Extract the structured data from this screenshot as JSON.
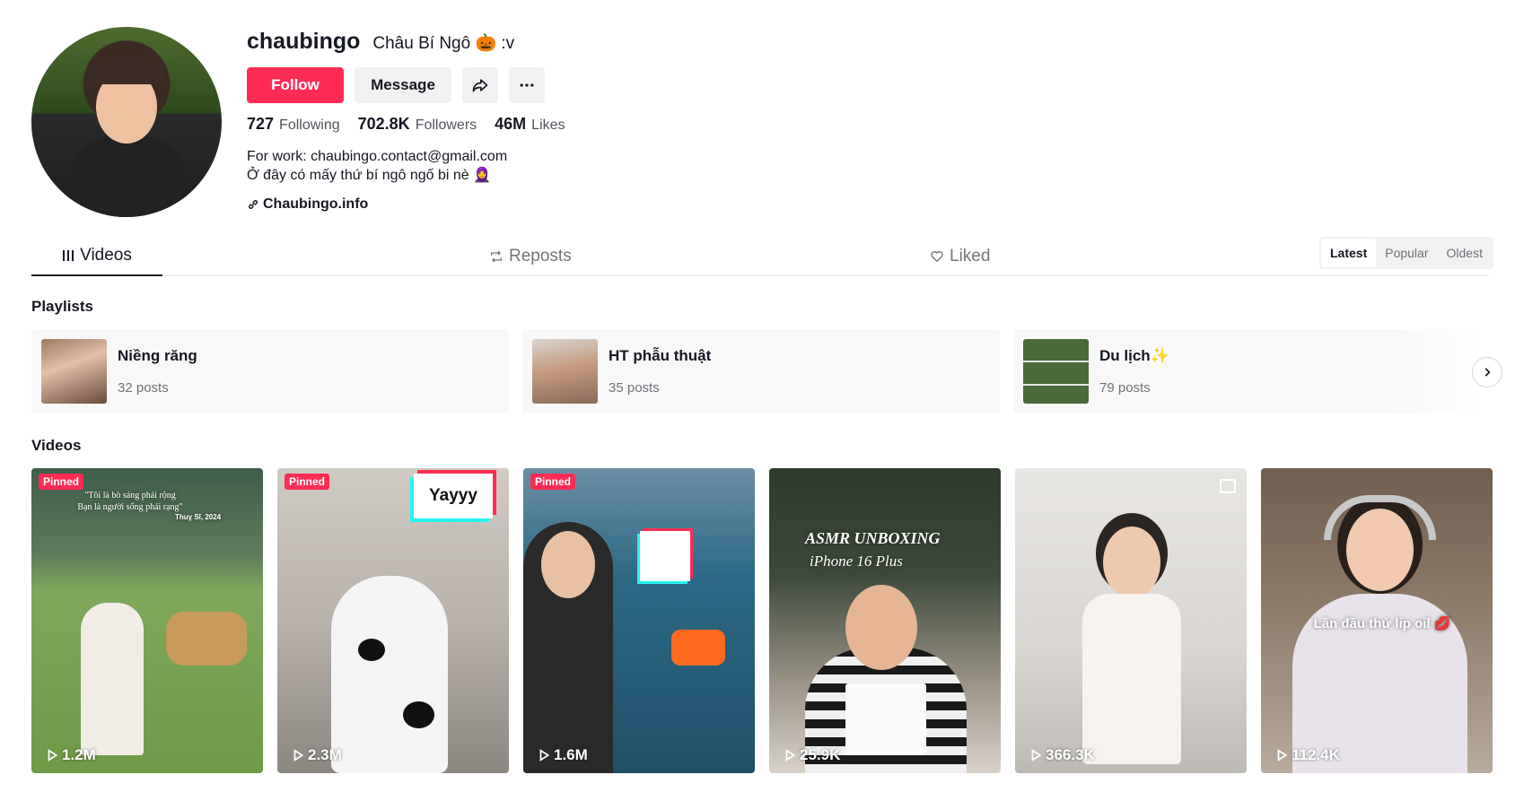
{
  "profile": {
    "username": "chaubingo",
    "nickname": "Châu Bí Ngô 🎃 :v",
    "follow_label": "Follow",
    "message_label": "Message",
    "share_icon": "share-icon",
    "more_icon": "more-icon",
    "stats": {
      "following_count": "727",
      "following_label": "Following",
      "followers_count": "702.8K",
      "followers_label": "Followers",
      "likes_count": "46M",
      "likes_label": "Likes"
    },
    "bio_line1": "For work: chaubingo.contact@gmail.com",
    "bio_line2": "Ở đây có mấy thứ bí ngô ngố bi nè 🧕",
    "link": "Chaubingo.info"
  },
  "tabs": {
    "videos": "Videos",
    "reposts": "Reposts",
    "liked": "Liked"
  },
  "sort": {
    "latest": "Latest",
    "popular": "Popular",
    "oldest": "Oldest"
  },
  "sections": {
    "playlists": "Playlists",
    "videos": "Videos"
  },
  "playlists": [
    {
      "title": "Niềng răng",
      "count": "32 posts"
    },
    {
      "title": "HT phẫu thuật",
      "count": "35 posts"
    },
    {
      "title": "Du lịch✨",
      "count": "79 posts"
    }
  ],
  "videos": [
    {
      "pinned": "Pinned",
      "views": "1.2M",
      "overlay": "\"Tôi là bò sáng phải rộng\nBạn là người sống phải rạng\"",
      "overlay2": "Thuỵ Sĩ, 2024"
    },
    {
      "pinned": "Pinned",
      "views": "2.3M",
      "overlay": "Yayyy"
    },
    {
      "pinned": "Pinned",
      "views": "1.6M"
    },
    {
      "views": "25.9K",
      "overlay": "ASMR UNBOXING",
      "overlay2": "iPhone 16 Plus"
    },
    {
      "views": "366.3K"
    },
    {
      "views": "112.4K",
      "overlay": "Lần đầu thử lip oil 💋"
    }
  ],
  "colors": {
    "accent": "#fe2c55",
    "text": "#161823",
    "muted": "#8a8b91",
    "surface": "#f1f1f2"
  }
}
